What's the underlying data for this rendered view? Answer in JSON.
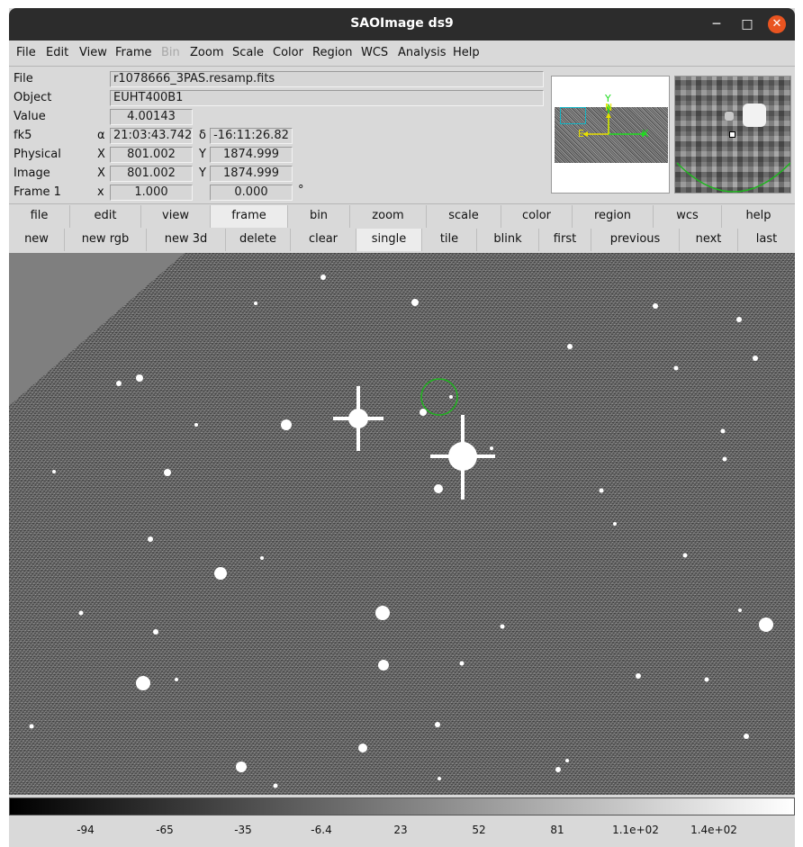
{
  "window": {
    "title": "SAOImage ds9",
    "minimize_glyph": "─",
    "maximize_glyph": "□",
    "close_glyph": "✕"
  },
  "menubar": [
    "File",
    "Edit",
    "View",
    "Frame",
    "Bin",
    "Zoom",
    "Scale",
    "Color",
    "Region",
    "WCS",
    "Analysis",
    "Help"
  ],
  "info": {
    "file_label": "File",
    "file_value": "r1078666_3PAS.resamp.fits",
    "object_label": "Object",
    "object_value": "EUHT400B1",
    "value_label": "Value",
    "value_value": "4.00143",
    "fk5_label": "fk5",
    "alpha_symbol": "α",
    "alpha_value": "21:03:43.742",
    "delta_symbol": "δ",
    "delta_value": "-16:11:26.82",
    "physical_label": "Physical",
    "physical_x_label": "X",
    "physical_x": "801.002",
    "physical_y_label": "Y",
    "physical_y": "1874.999",
    "image_label": "Image",
    "image_x_label": "X",
    "image_x": "801.002",
    "image_y_label": "Y",
    "image_y": "1874.999",
    "frame_label": "Frame 1",
    "frame_x_label": "x",
    "frame_zoom": "1.000",
    "frame_angle": "0.000",
    "degree_symbol": "°"
  },
  "panner": {
    "compass_north": "N",
    "compass_east": "E",
    "axis_x": "X",
    "axis_y": "Y",
    "north_color": "#e8e000",
    "axis_color": "#1fdc1f",
    "box_color": "#13b3c4"
  },
  "buttonbar": {
    "row1": [
      "file",
      "edit",
      "view",
      "frame",
      "bin",
      "zoom",
      "scale",
      "color",
      "region",
      "wcs",
      "help"
    ],
    "row1_active": "frame",
    "row2": [
      "new",
      "new rgb",
      "new 3d",
      "delete",
      "clear",
      "single",
      "tile",
      "blink",
      "first",
      "previous",
      "next",
      "last"
    ],
    "row2_active": "single"
  },
  "region": {
    "shape": "circle",
    "color": "#1fb51f"
  },
  "colorbar": {
    "colormap": "grey",
    "ticks": [
      "-94",
      "-65",
      "-35",
      "-6.4",
      "23",
      "52",
      "81",
      "1.1e+02",
      "1.4e+02"
    ]
  }
}
